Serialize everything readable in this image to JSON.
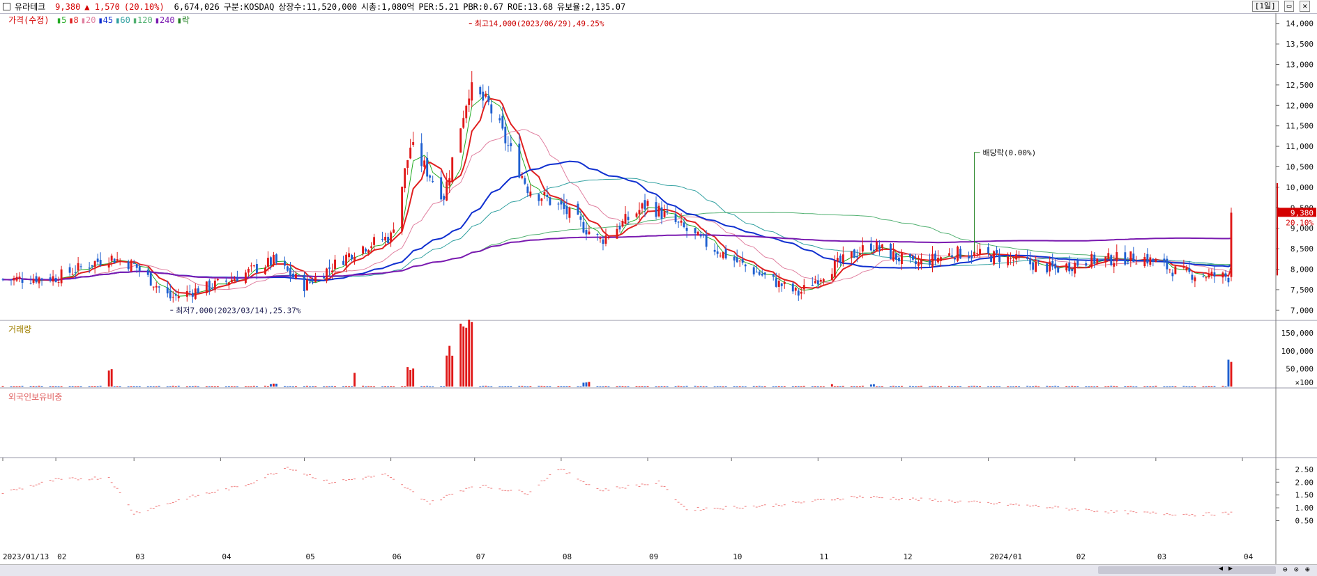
{
  "header": {
    "stock_name": "유라테크",
    "price": "9,380",
    "change": "▲ 1,570",
    "change_pct": "(20.10%)",
    "volume": "6,674,026",
    "market": "구분:KOSDAQ",
    "shares": "상장수:11,520,000",
    "mcap": "시총:1,080억",
    "per": "PER:5.21",
    "pbr": "PBR:0.67",
    "roe": "ROE:13.68",
    "retention": "유보율:2,135.07",
    "period_button": "[1일]"
  },
  "legend": {
    "price_label": "가격(수정)",
    "ma": [
      {
        "label": "5",
        "color": "#22aa22"
      },
      {
        "label": "8",
        "color": "#e02020"
      },
      {
        "label": "20",
        "color": "#e080a0"
      },
      {
        "label": "45",
        "color": "#1030d0"
      },
      {
        "label": "60",
        "color": "#30a0a0"
      },
      {
        "label": "120",
        "color": "#50b070"
      },
      {
        "label": "240",
        "color": "#7a1ab0"
      },
      {
        "label": "락",
        "color": "#208020"
      }
    ],
    "volume_label": "거래량",
    "foreign_label": "외국인보유비중"
  },
  "annotations": {
    "high": "최고14,000(2023/06/29),49.25%",
    "low": "최저7,000(2023/03/14),25.37%",
    "dividend": "배당락(0.00%)",
    "last_price_tag": "9,380",
    "last_pct_tag": "20.10%"
  },
  "colors": {
    "up": "#e01818",
    "down": "#1e5fd0",
    "foreign_bar": "#f08080",
    "ma240": "#7a1ab0",
    "ma45": "#1030d0"
  },
  "chart_data": [
    {
      "type": "candlestick",
      "title": "",
      "y_ticks": [
        "14,000",
        "13,500",
        "13,000",
        "12,500",
        "12,000",
        "11,500",
        "11,000",
        "10,500",
        "10,000",
        "9,500",
        "9,000",
        "8,500",
        "8,000",
        "7,500",
        "7,000"
      ],
      "ylim": [
        6750,
        14250
      ],
      "x_labels": [
        "2023/01/13",
        "02",
        "03",
        "04",
        "05",
        "06",
        "07",
        "08",
        "09",
        "10",
        "11",
        "12",
        "2024/01",
        "02",
        "03",
        "04"
      ],
      "series_close": [
        {
          "x": "2023-01-13",
          "y": 7750
        },
        {
          "x": "2023-02-01",
          "y": 7800
        },
        {
          "x": "2023-02-20",
          "y": 8300
        },
        {
          "x": "2023-03-01",
          "y": 8100
        },
        {
          "x": "2023-03-14",
          "y": 7300
        },
        {
          "x": "2023-04-03",
          "y": 7700
        },
        {
          "x": "2023-04-20",
          "y": 8200
        },
        {
          "x": "2023-05-01",
          "y": 7600
        },
        {
          "x": "2023-05-20",
          "y": 8500
        },
        {
          "x": "2023-06-01",
          "y": 8800
        },
        {
          "x": "2023-06-08",
          "y": 11000
        },
        {
          "x": "2023-06-20",
          "y": 9800
        },
        {
          "x": "2023-06-29",
          "y": 12400
        },
        {
          "x": "2023-07-06",
          "y": 12000
        },
        {
          "x": "2023-07-20",
          "y": 10000
        },
        {
          "x": "2023-08-01",
          "y": 9500
        },
        {
          "x": "2023-08-15",
          "y": 8700
        },
        {
          "x": "2023-09-01",
          "y": 9600
        },
        {
          "x": "2023-09-20",
          "y": 8700
        },
        {
          "x": "2023-10-05",
          "y": 8100
        },
        {
          "x": "2023-10-25",
          "y": 7400
        },
        {
          "x": "2023-11-05",
          "y": 8000
        },
        {
          "x": "2023-11-20",
          "y": 8600
        },
        {
          "x": "2023-12-05",
          "y": 8100
        },
        {
          "x": "2023-12-20",
          "y": 8400
        },
        {
          "x": "2024-01-05",
          "y": 8300
        },
        {
          "x": "2024-01-25",
          "y": 8000
        },
        {
          "x": "2024-02-05",
          "y": 8200
        },
        {
          "x": "2024-02-25",
          "y": 8300
        },
        {
          "x": "2024-03-10",
          "y": 7900
        },
        {
          "x": "2024-03-27",
          "y": 7810
        },
        {
          "x": "2024-03-28",
          "y": 9380
        }
      ]
    },
    {
      "type": "bar",
      "title": "",
      "y_ticks": [
        "150,000",
        "100,000",
        "50,000",
        "×100"
      ],
      "ylim": [
        0,
        170000
      ],
      "peaks": [
        {
          "x": "2023-02-20",
          "y": 45000
        },
        {
          "x": "2023-04-20",
          "y": 8000
        },
        {
          "x": "2023-05-20",
          "y": 45000
        },
        {
          "x": "2023-06-08",
          "y": 55000
        },
        {
          "x": "2023-06-22",
          "y": 100000
        },
        {
          "x": "2023-06-26",
          "y": 155000
        },
        {
          "x": "2023-06-29",
          "y": 165000
        },
        {
          "x": "2023-08-10",
          "y": 12000
        },
        {
          "x": "2023-11-05",
          "y": 8000
        },
        {
          "x": "2023-11-20",
          "y": 6000
        },
        {
          "x": "2024-03-28",
          "y": 66740
        }
      ]
    },
    {
      "type": "bar",
      "title": "",
      "y_ticks": [
        "2.50",
        "2.00",
        "1.50",
        "1.00",
        "0.50"
      ],
      "ylim": [
        0.35,
        2.85
      ],
      "points": [
        {
          "x": "2023-01-13",
          "y": 1.6
        },
        {
          "x": "2023-02-01",
          "y": 2.1
        },
        {
          "x": "2023-02-20",
          "y": 2.2
        },
        {
          "x": "2023-03-01",
          "y": 0.8
        },
        {
          "x": "2023-03-20",
          "y": 1.4
        },
        {
          "x": "2023-04-10",
          "y": 1.9
        },
        {
          "x": "2023-04-25",
          "y": 2.6
        },
        {
          "x": "2023-05-10",
          "y": 2.0
        },
        {
          "x": "2023-05-30",
          "y": 2.3
        },
        {
          "x": "2023-06-15",
          "y": 1.2
        },
        {
          "x": "2023-07-01",
          "y": 1.9
        },
        {
          "x": "2023-07-20",
          "y": 1.6
        },
        {
          "x": "2023-07-31",
          "y": 2.55
        },
        {
          "x": "2023-08-15",
          "y": 1.7
        },
        {
          "x": "2023-09-05",
          "y": 2.0
        },
        {
          "x": "2023-09-15",
          "y": 0.95
        },
        {
          "x": "2023-10-15",
          "y": 1.1
        },
        {
          "x": "2023-11-15",
          "y": 1.45
        },
        {
          "x": "2023-12-15",
          "y": 1.3
        },
        {
          "x": "2024-01-15",
          "y": 1.1
        },
        {
          "x": "2024-02-15",
          "y": 0.85
        },
        {
          "x": "2024-03-15",
          "y": 0.75
        },
        {
          "x": "2024-03-28",
          "y": 0.8
        }
      ]
    }
  ]
}
